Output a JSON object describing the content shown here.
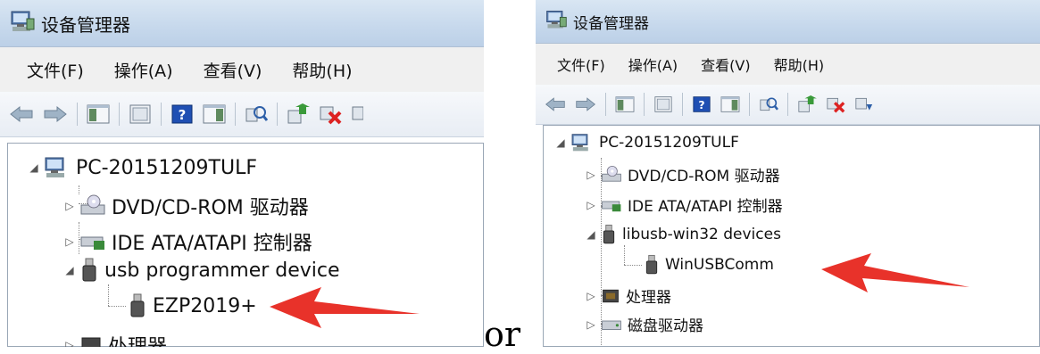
{
  "left": {
    "window_title": "设备管理器",
    "menu": [
      "文件(F)",
      "操作(A)",
      "查看(V)",
      "帮助(H)"
    ],
    "tree": {
      "root": "PC-20151209TULF",
      "items": [
        "DVD/CD-ROM 驱动器",
        "IDE ATA/ATAPI 控制器",
        "usb programmer device"
      ],
      "child": "EZP2019+",
      "next_partial": "处理器"
    }
  },
  "separator_text": "or",
  "right": {
    "window_title": "设备管理器",
    "menu": [
      "文件(F)",
      "操作(A)",
      "查看(V)",
      "帮助(H)"
    ],
    "tree": {
      "root": "PC-20151209TULF",
      "items": [
        "DVD/CD-ROM 驱动器",
        "IDE ATA/ATAPI 控制器",
        "libusb-win32 devices"
      ],
      "child": "WinUSBComm",
      "after": [
        "处理器",
        "磁盘驱动器"
      ]
    }
  },
  "colors": {
    "arrow": "#e8322a",
    "titlebar": "#c6d8ec"
  }
}
